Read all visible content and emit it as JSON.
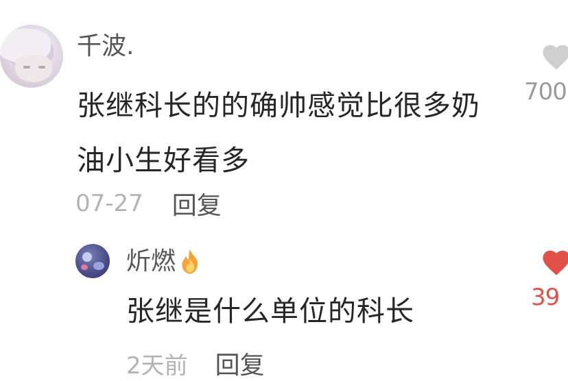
{
  "comment": {
    "username": "千波.",
    "content": "张继科长的的确帅感觉比很多奶油小生好看多",
    "date": "07-27",
    "reply_label": "回复",
    "like_count": "700",
    "like_state": "not-liked",
    "like_color": "#cfcfcf",
    "avatar_icon": "anime-avatar-icon",
    "like_icon": "heart-icon"
  },
  "reply": {
    "username": "炘燃",
    "username_badge_icon": "fire-icon",
    "content": "张继是什么单位的科长",
    "date": "2天前",
    "reply_label": "回复",
    "like_count": "39",
    "like_state": "liked",
    "like_color": "#e2504a",
    "avatar_icon": "user-avatar-icon",
    "like_icon": "heart-icon"
  },
  "colors": {
    "text_primary": "#262626",
    "text_secondary": "#555555",
    "text_meta": "#b3b3b3",
    "accent_like": "#e2504a"
  }
}
